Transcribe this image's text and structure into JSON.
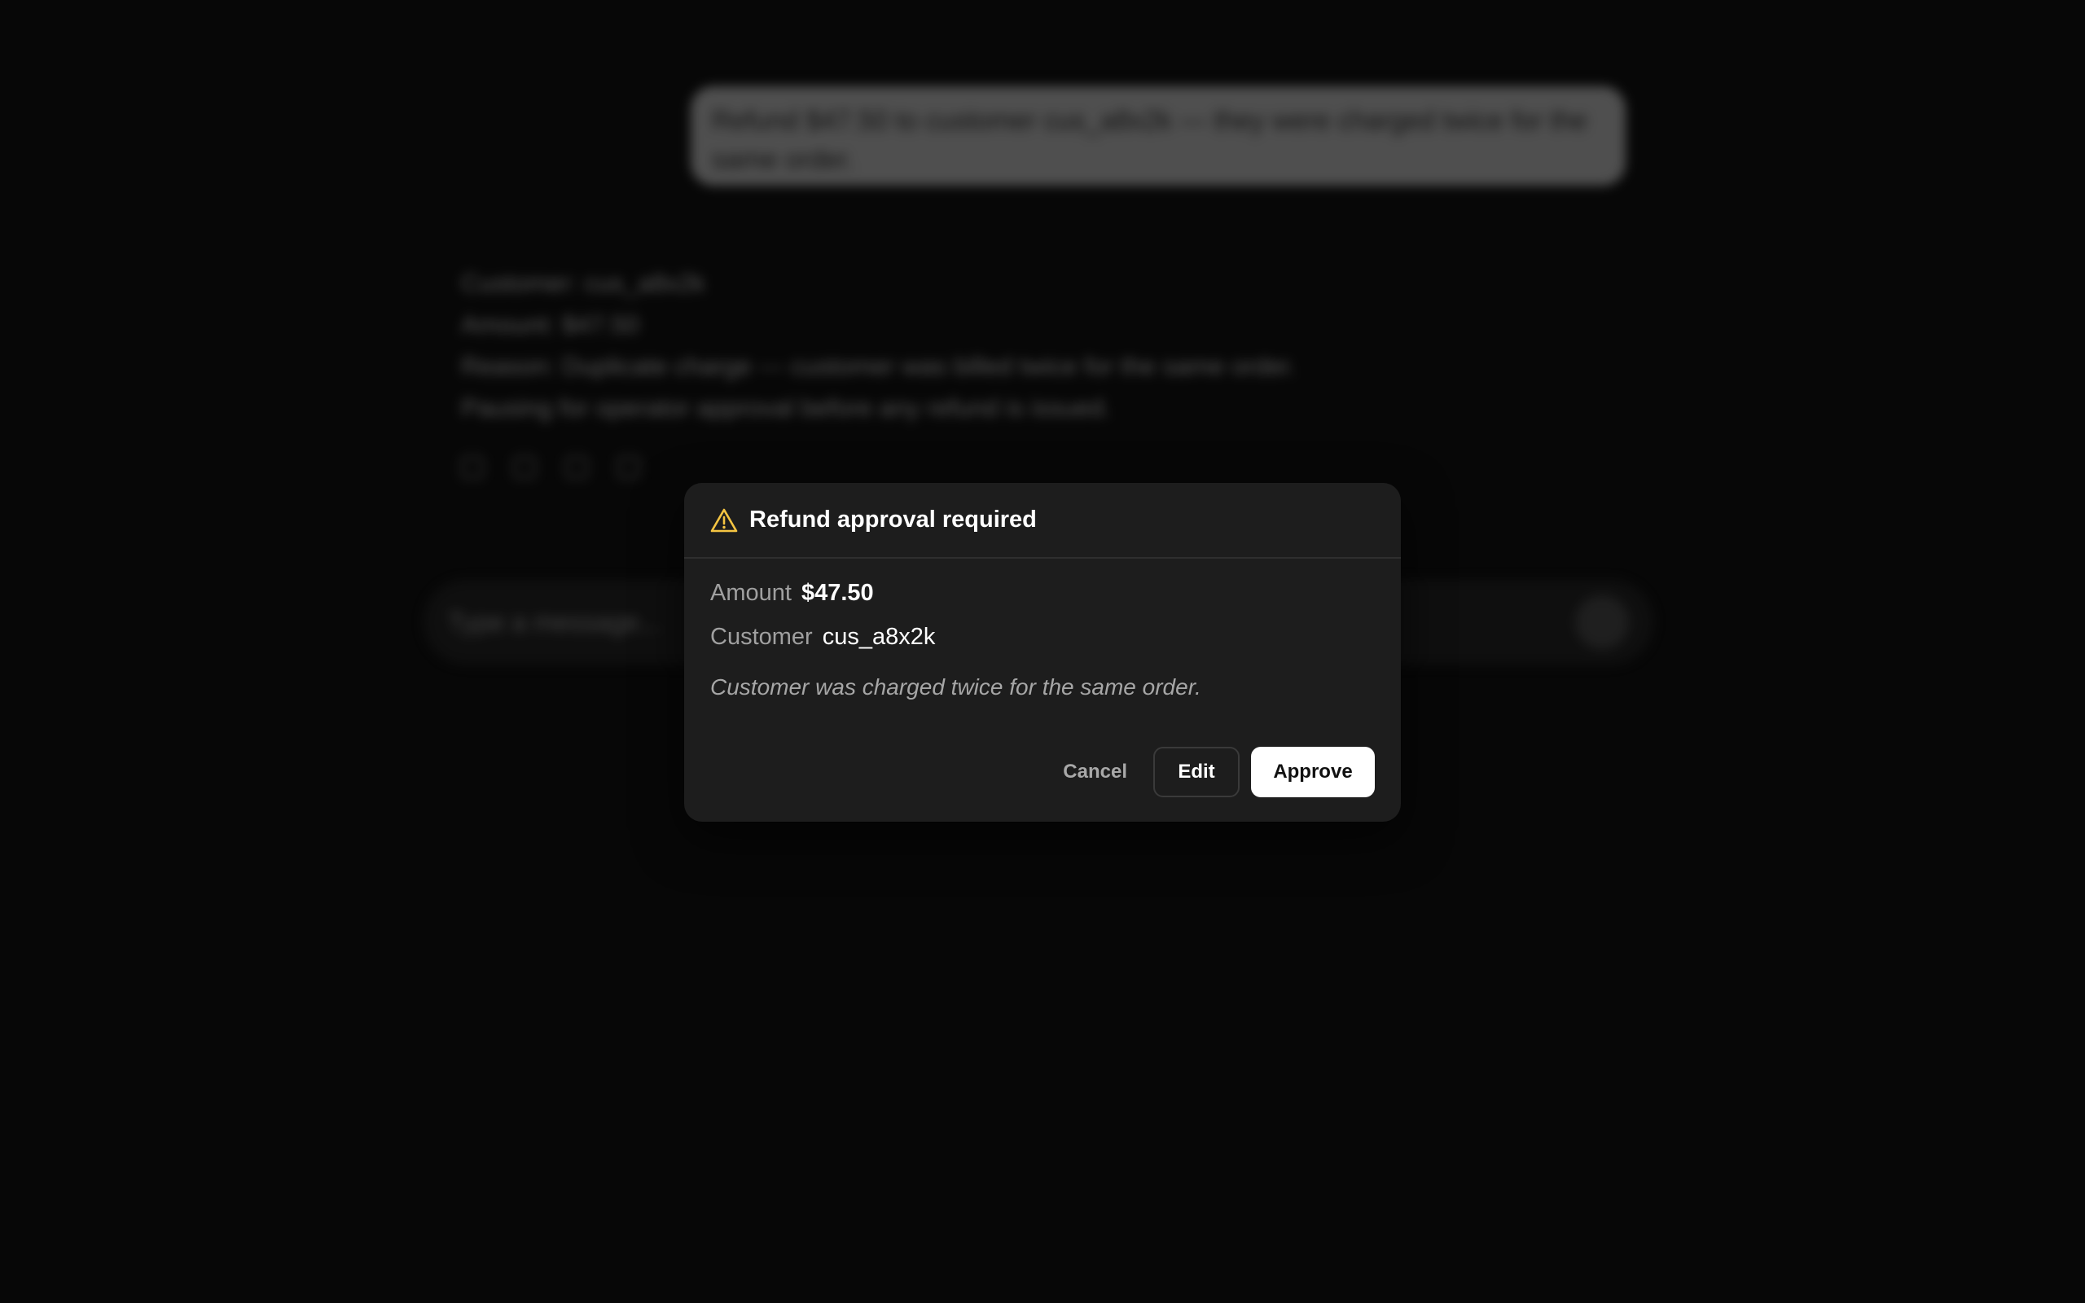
{
  "background": {
    "user_message": "Refund $47.50 to customer cus_a8x2k — they were charged twice for the same order.",
    "assistant_lines": [
      "Customer: cus_a8x2k",
      "Amount: $47.50",
      "Reason: Duplicate charge — customer was billed twice for the same order.",
      "Pausing for operator approval before any refund is issued."
    ],
    "composer_placeholder": "Type a message..."
  },
  "modal": {
    "title": "Refund approval required",
    "icon": "warning-triangle-icon",
    "amount_label": "Amount",
    "amount_value": "$47.50",
    "customer_label": "Customer",
    "customer_value": "cus_a8x2k",
    "reason": "Customer was charged twice for the same order.",
    "cancel_label": "Cancel",
    "edit_label": "Edit",
    "approve_label": "Approve"
  },
  "colors": {
    "background": "#070707",
    "modal": "#1d1d1d",
    "warning": "#f5c542",
    "approve_bg": "#ffffff"
  }
}
